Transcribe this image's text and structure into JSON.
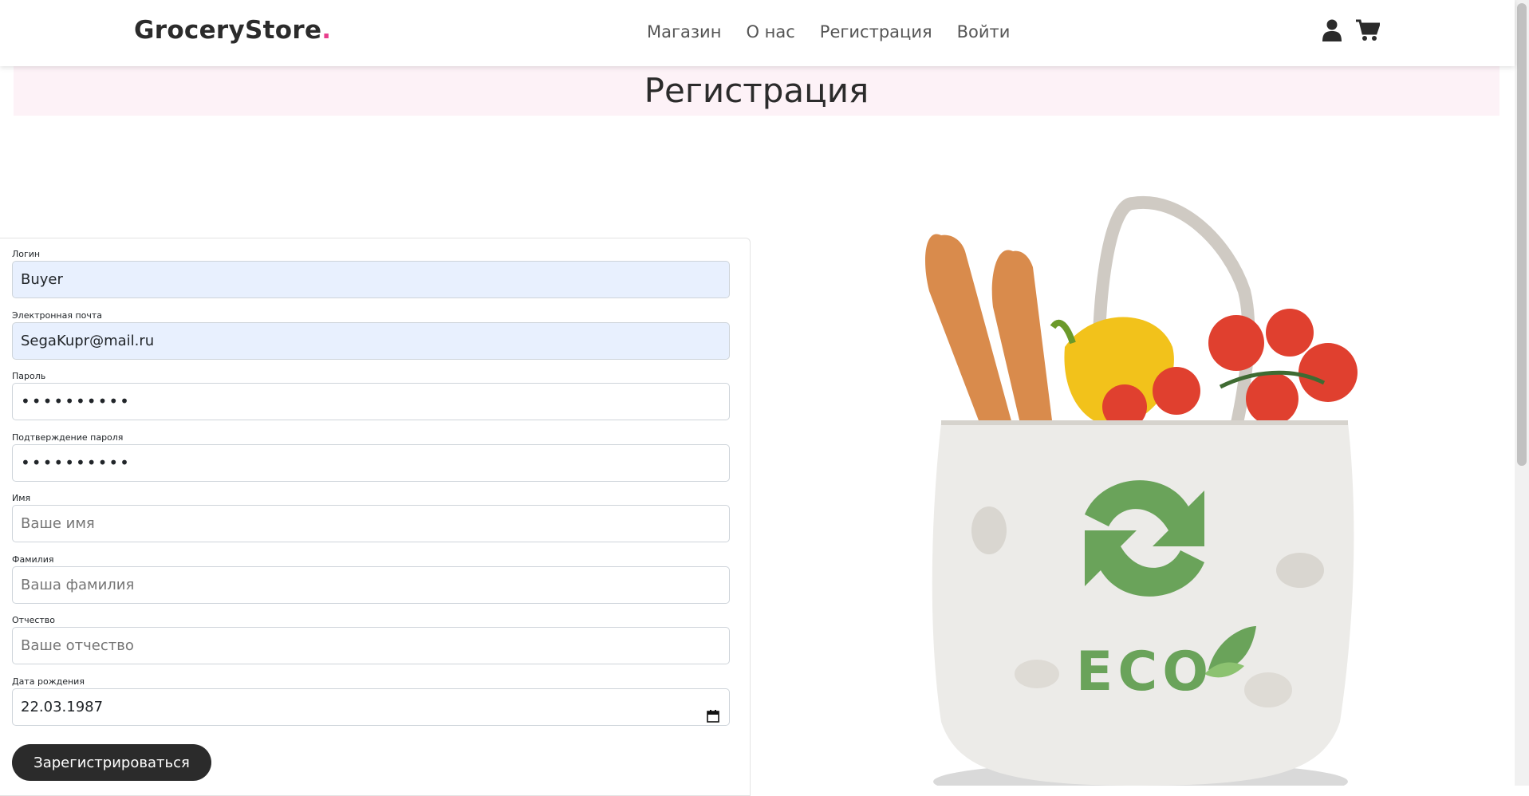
{
  "navbar": {
    "brand": "GroceryStore",
    "brand_dot": ".",
    "links": [
      "Магазин",
      "О нас",
      "Регистрация",
      "Войти"
    ],
    "icons": [
      "user-icon",
      "cart-icon"
    ]
  },
  "page": {
    "title": "Регистрация"
  },
  "form": {
    "login": {
      "label": "Логин",
      "value": "Buyer"
    },
    "email": {
      "label": "Электронная почта",
      "value": "SegaKupr@mail.ru"
    },
    "password": {
      "label": "Пароль",
      "value": "••••••••••"
    },
    "password_confirm": {
      "label": "Подтверждение пароля",
      "value": "••••••••••"
    },
    "first_name": {
      "label": "Имя",
      "placeholder": "Ваше имя"
    },
    "last_name": {
      "label": "Фамилия",
      "placeholder": "Ваша фамилия"
    },
    "middle_name": {
      "label": "Отчество",
      "placeholder": "Ваше отчество"
    },
    "birth_date": {
      "label": "Дата рождения",
      "value": "22.03.1987"
    },
    "submit_label": "Зарегистрироваться"
  },
  "hero_image": {
    "text": "ECO"
  },
  "colors": {
    "accent": "#e83e8c",
    "header_bg": "#fdf2f7",
    "button_bg": "#2b2b2b",
    "autofill_bg": "#e8f0fe",
    "eco_green": "#6aa35a"
  }
}
